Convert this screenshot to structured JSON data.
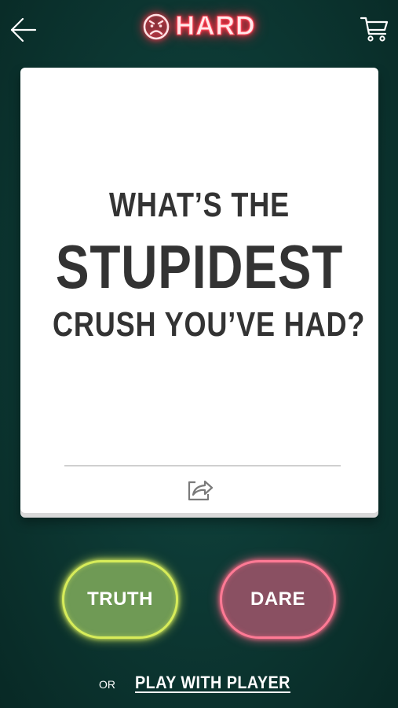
{
  "header": {
    "back_icon": "arrow-left-icon",
    "difficulty": "HARD",
    "difficulty_icon": "sad-face-icon",
    "cart_icon": "shopping-cart-icon",
    "accent_color": "#ff3b4e"
  },
  "card": {
    "question_lines": [
      "WHAT’S THE",
      "STUPIDEST",
      "CRUSH YOU’VE HAD?"
    ],
    "share_icon": "share-icon"
  },
  "actions": {
    "truth_label": "TRUTH",
    "dare_label": "DARE",
    "truth_color": "#6f9a55",
    "dare_color": "#8a5062"
  },
  "footer": {
    "or_label": "OR",
    "play_with_player_label": "PLAY WITH PLAYER"
  }
}
